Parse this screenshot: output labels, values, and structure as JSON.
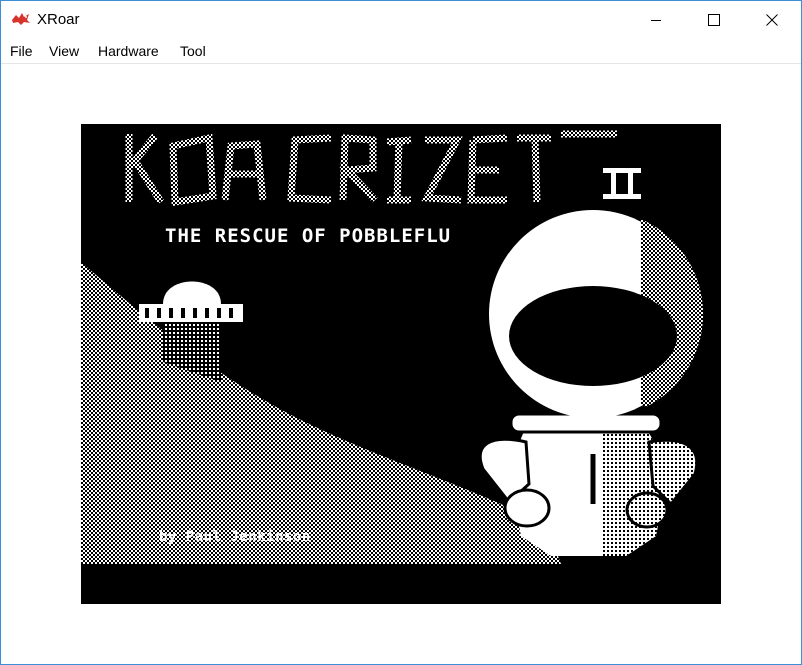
{
  "window": {
    "title": "XRoar",
    "icon": "xroar-dragon-icon",
    "controls": [
      "minimize-icon",
      "maximize-icon",
      "close-icon"
    ]
  },
  "menu": {
    "items": [
      {
        "label": "File"
      },
      {
        "label": "View"
      },
      {
        "label": "Hardware"
      },
      {
        "label": "Tool"
      }
    ]
  },
  "screen": {
    "subtitle": "THE  RESCUE  OF POBBLEFLU",
    "numeral": "II",
    "credit": "by  Paul  Jenkinson"
  },
  "colors": {
    "accent_border": "#3c8fd6",
    "screen_bg": "#000000",
    "screen_fg": "#ffffff",
    "dragon_red": "#d9342b"
  }
}
